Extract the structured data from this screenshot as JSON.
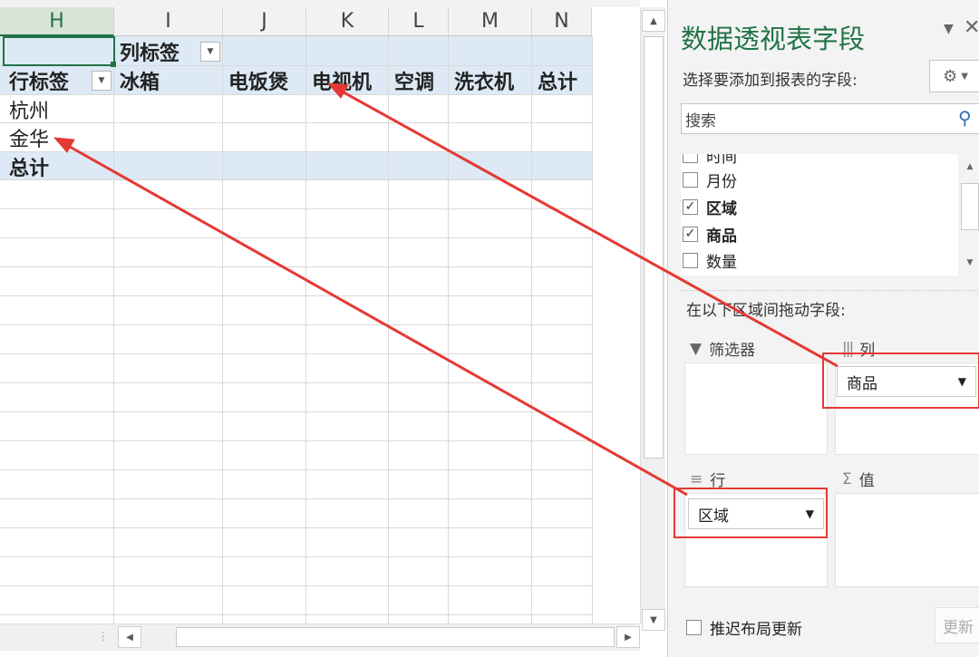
{
  "columns": [
    {
      "label": "H",
      "selected": true
    },
    {
      "label": "I",
      "selected": false
    },
    {
      "label": "J",
      "selected": false
    },
    {
      "label": "K",
      "selected": false
    },
    {
      "label": "L",
      "selected": false
    },
    {
      "label": "M",
      "selected": false
    },
    {
      "label": "N",
      "selected": false
    }
  ],
  "pivot": {
    "col_labels_caption": "列标签",
    "row_labels_caption": "行标签",
    "col_items": [
      "冰箱",
      "电饭煲",
      "电视机",
      "空调",
      "洗衣机",
      "总计"
    ],
    "row_items": [
      "杭州",
      "金华"
    ],
    "grand_total": "总计"
  },
  "panel": {
    "title": "数据透视表字段",
    "choose_fields": "选择要添加到报表的字段:",
    "search_placeholder": "搜索",
    "fields": [
      {
        "name": "时间",
        "checked": false,
        "bold": false
      },
      {
        "name": "月份",
        "checked": false,
        "bold": false
      },
      {
        "name": "区域",
        "checked": true,
        "bold": true
      },
      {
        "name": "商品",
        "checked": true,
        "bold": true
      },
      {
        "name": "数量",
        "checked": false,
        "bold": false
      }
    ],
    "drag_hint": "在以下区域间拖动字段:",
    "areas": {
      "filters": "筛选器",
      "columns": "列",
      "rows": "行",
      "values": "值"
    },
    "column_field": "商品",
    "row_field": "区域",
    "defer_label": "推迟布局更新",
    "update_label": "更新"
  },
  "colors": {
    "accent": "#217346",
    "highlight": "#e53935",
    "band": "#dde9f5"
  }
}
